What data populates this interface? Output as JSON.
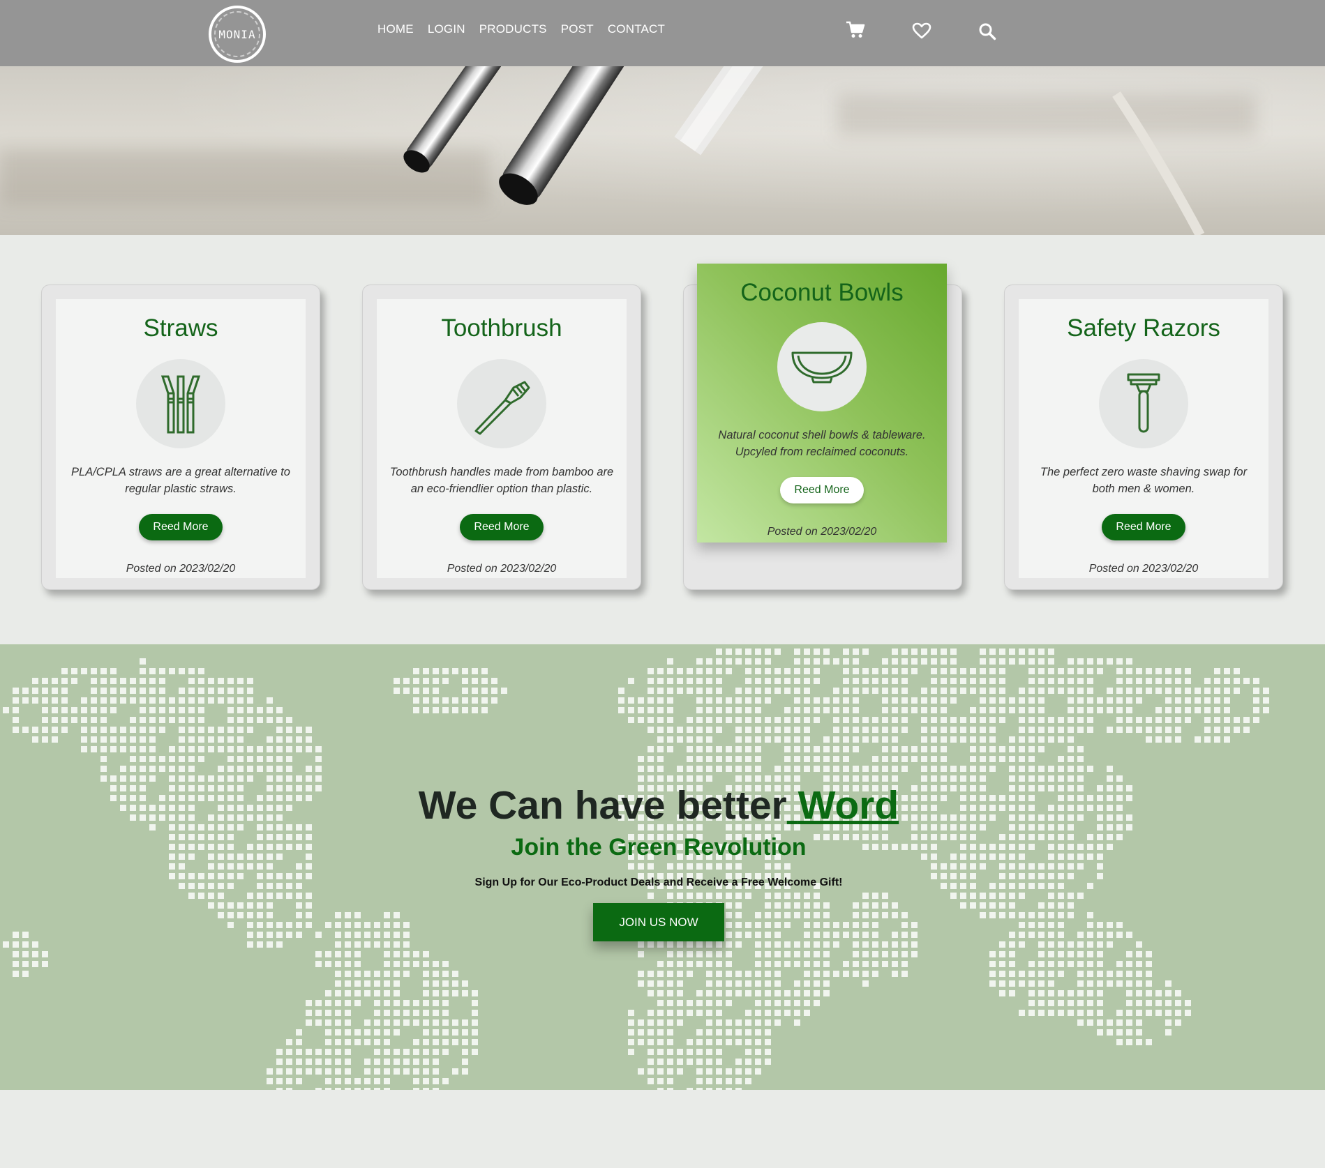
{
  "header": {
    "logo_text": "MONIA",
    "nav": [
      "HOME",
      "LOGIN",
      "PRODUCTS",
      "POST",
      "CONTACT"
    ],
    "icons": [
      "cart-icon",
      "heart-icon",
      "search-icon"
    ]
  },
  "cards": [
    {
      "title": "Straws",
      "icon": "straws-icon",
      "description": "PLA/CPLA straws are a great alternative to regular plastic straws.",
      "button": "Reed More",
      "posted": "Posted on 2023/02/20"
    },
    {
      "title": "Toothbrush",
      "icon": "toothbrush-icon",
      "description": "Toothbrush handles made from bamboo are an eco-friendlier option than plastic.",
      "button": "Reed More",
      "posted": "Posted on 2023/02/20"
    },
    {
      "title": "Coconut Bowls",
      "icon": "bowl-icon",
      "description": "Natural coconut shell bowls & tableware. Upcyled from reclaimed coconuts.",
      "button": "Reed More",
      "posted": "Posted on 2023/02/20"
    },
    {
      "title": "Safety Razors",
      "icon": "razor-icon",
      "description": "The perfect zero waste shaving swap for both men & women.",
      "button": "Reed More",
      "posted": "Posted on 2023/02/20"
    }
  ],
  "cta": {
    "headline_main": "We Can have better",
    "headline_word": "Word",
    "subheadline": "Join the Green Revolution",
    "signup_text": "Sign Up for Our Eco-Product Deals and Receive a Free Welcome Gift!",
    "button": "JOIN US NOW"
  },
  "colors": {
    "brand_green": "#0b6a12",
    "header_gray": "#959595",
    "map_bg": "#b3c7a8",
    "page_bg": "#e9ebe8"
  }
}
